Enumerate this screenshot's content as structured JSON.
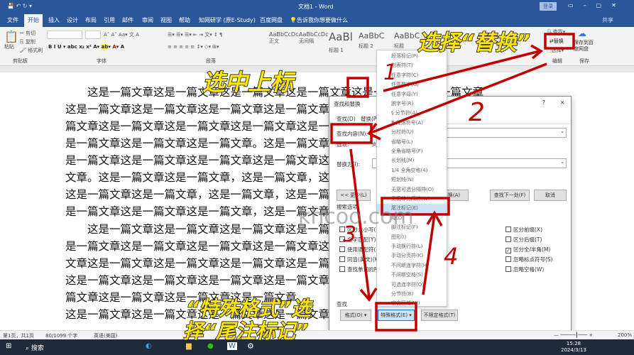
{
  "window": {
    "title": "文档1 - Word",
    "login": "登录",
    "share": "共享"
  },
  "tabs": [
    "文件",
    "开始",
    "插入",
    "设计",
    "布局",
    "引用",
    "邮件",
    "审阅",
    "视图",
    "帮助",
    "知网研学 (原E-Study)",
    "百度网盘"
  ],
  "tell_me": "告诉我你想要做什么",
  "ribbon": {
    "clipboard": {
      "paste": "粘贴",
      "cut": "剪切",
      "copy": "复制",
      "format_painter": "格式刷",
      "label": "剪贴板"
    },
    "font_label": "字体",
    "paragraph_label": "段落",
    "styles": [
      {
        "preview": "AaBbCcDc",
        "name": "正文"
      },
      {
        "preview": "AaBbCcDc",
        "name": "无间隔"
      },
      {
        "preview": "AaBl",
        "name": "标题 1"
      },
      {
        "preview": "AaBbC",
        "name": "标题 2"
      },
      {
        "preview": "AaBbC",
        "name": "标题"
      }
    ],
    "editing": {
      "find": "查找",
      "replace": "替换",
      "select": "选择",
      "label": "编辑"
    },
    "save": {
      "button": "保存到百度网盘",
      "label": "保存"
    }
  },
  "document": {
    "lines": [
      "这是一篇文章这是一篇文章这是一篇文章这是一篇文章这是一篇文章这是一篇文章",
      "这是一篇文章这是一篇文章这是一篇文章这是一篇文章这是一篇文章这是一篇文章",
      "篇文章这是一篇文章这是一篇文章这是一篇文章这是一篇文章这是一篇文章",
      "是一篇文章这是一篇文章这是一篇文章。这是一篇文章，这是一篇文章",
      "是一篇文章这是一篇文章这是一篇文章这是一篇文章这是一篇文章这是一篇文章",
      "文章。这是一篇文章这是一篇文章，这是一篇文章，这是一篇文章",
      "这是一篇文章这是一篇文章，这是一篇文章，这是一篇文章",
      "是一篇文章这是一篇文章这是一篇文章，这是一篇文章",
      "这是一篇文章这是一篇文章这是一篇文章这是一篇文章",
      "是一篇文章这是一篇文章这是一篇文章这是一篇文章这是一篇文章",
      "文章这是一篇文章这是一篇文章这是一篇文章这是一篇文章",
      "这是一篇文章这是一篇文章这是一篇文章这是一篇文章，这是一篇文章",
      "篇文章这是一篇文章这是一篇文章这是一篇文章",
      "这是一篇文章这是一篇文章这是一篇文章这是一篇文章"
    ]
  },
  "dialog": {
    "title": "查找和替换",
    "help": "?",
    "close": "✕",
    "tabs": [
      "查找(D)",
      "替换(P)"
    ],
    "find_label": "查找内容(N):",
    "options_label": "选项:",
    "options_value": "向下",
    "replace_label": "替换为(I):",
    "less_button": "<< 更少(L)",
    "replace_all": "全部替换(A)",
    "find_next": "查找下一处(F)",
    "cancel": "取消",
    "search_options": "搜索选项",
    "left_checks": [
      {
        "label": "区分大小写(H)",
        "checked": false
      },
      {
        "label": "全字匹配(Y)",
        "checked": false
      },
      {
        "label": "使用通配符(U)",
        "checked": false
      },
      {
        "label": "同音(英文)(K)",
        "checked": false
      },
      {
        "label": "查找单词的所有形式(英文)(W)",
        "checked": false
      }
    ],
    "right_checks": [
      {
        "label": "区分前缀(X)",
        "checked": false
      },
      {
        "label": "区分后缀(T)",
        "checked": false
      },
      {
        "label": "区分全/半角(M)",
        "checked": true
      },
      {
        "label": "忽略标点符号(S)",
        "checked": false
      },
      {
        "label": "忽略空格(W)",
        "checked": false
      }
    ],
    "find_section": "查找",
    "format_button": "格式(O) ▾",
    "special_button": "特殊格式(E) ▾",
    "no_format_button": "不限定格式(T)"
  },
  "special_menu": {
    "items": [
      "段落标记(P)",
      "制表符(T)",
      "任意字符(C)",
      "任意数字(G)",
      "任意字母(Y)",
      "脱字号(R)",
      "§ 分节符(A)",
      "¶ 段落符号(A)",
      "分栏符(U)",
      "省略号(L)",
      "全角省略号(F)",
      "长划线(M)",
      "1/4 全角空格(4)",
      "短划线(N)",
      "无宽可选分隔符(O)",
      "无宽非分隔符(W)",
      "尾注标记(E)",
      "域(D)",
      "脚注标记(F)",
      "图形(I)",
      "手动换行符(L)",
      "手动分页符(K)",
      "不间断连字符(H)",
      "不间断空格(S)",
      "可选连字符(O)",
      "分节符(B)",
      "空白区域(W)"
    ],
    "highlighted": "尾注标记(E)"
  },
  "annotations": {
    "a1": "选择“替换”",
    "a2": "选中上标",
    "a3": "“特殊格式”选",
    "a4": "择“尾注标记”",
    "n1": "1",
    "n2": "2",
    "n3": "3",
    "n4": "4",
    "watermark": "khcoo.com",
    "color": "#c00000"
  },
  "status": {
    "page": "第1页，共1页",
    "words": "80/1099 个字",
    "lang": "英语(美国)",
    "zoom": "200%"
  },
  "taskbar": {
    "search": "搜索",
    "time": "15:28",
    "date": "2024/3/13"
  }
}
